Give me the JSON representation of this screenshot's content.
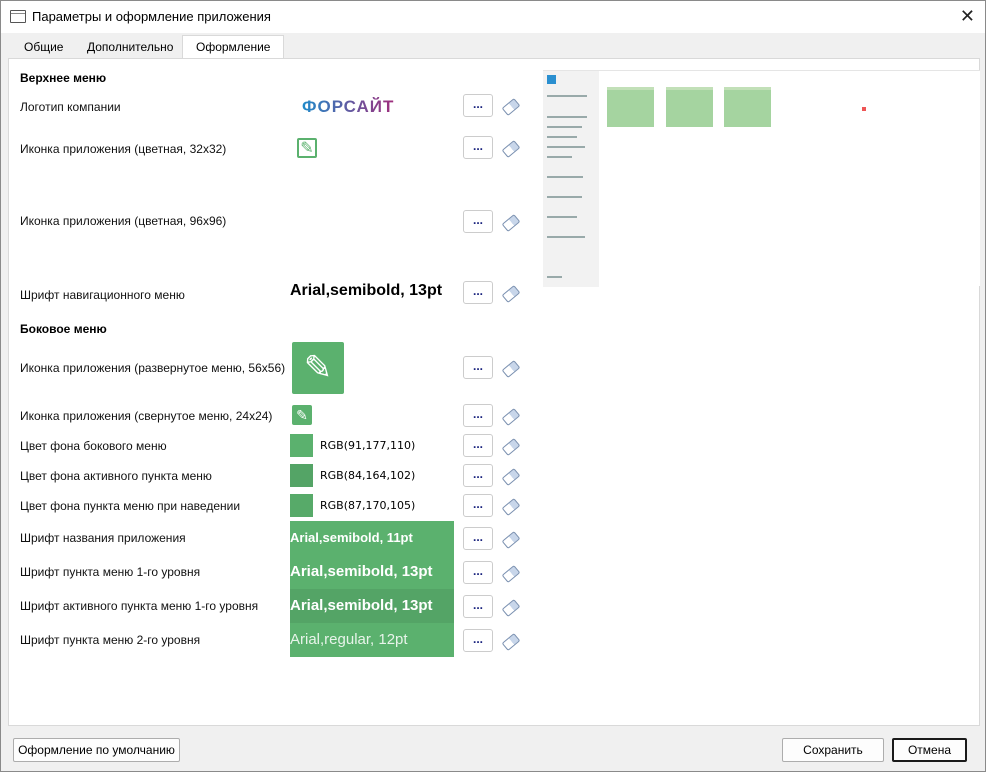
{
  "window": {
    "title": "Параметры и оформление приложения"
  },
  "tabs": [
    {
      "label": "Общие"
    },
    {
      "label": "Дополнительно"
    },
    {
      "label": "Оформление"
    }
  ],
  "top_menu": {
    "header": "Верхнее меню",
    "rows": [
      {
        "label": "Логотип компании",
        "logo_text": "ФОРСАЙТ"
      },
      {
        "label": "Иконка приложения (цветная, 32x32)"
      },
      {
        "label": "Иконка приложения (цветная, 96x96)"
      },
      {
        "label": "Шрифт навигационного меню",
        "value": "Arial,semibold, 13pt"
      }
    ]
  },
  "side_menu": {
    "header": "Боковое меню",
    "rows": [
      {
        "label": "Иконка приложения (развернутое меню, 56x56)"
      },
      {
        "label": "Иконка приложения (свернутое меню, 24x24)"
      },
      {
        "label": "Цвет фона бокового меню",
        "value": "RGB(91,177,110)",
        "color": "#5bb16e"
      },
      {
        "label": "Цвет фона активного пункта меню",
        "value": "RGB(84,164,102)",
        "color": "#54a466"
      },
      {
        "label": "Цвет фона пункта меню при наведении",
        "value": "RGB(87,170,105)",
        "color": "#57aa69"
      },
      {
        "label": "Шрифт названия приложения",
        "value": "Arial,semibold, 11pt"
      },
      {
        "label": "Шрифт пункта меню 1-го уровня",
        "value": "Arial,semibold, 13pt"
      },
      {
        "label": "Шрифт активного пункта меню 1-го уровня",
        "value": "Arial,semibold, 13pt"
      },
      {
        "label": "Шрифт пункта меню 2-го уровня",
        "value": "Arial,regular, 12pt"
      }
    ]
  },
  "browse_label": "...",
  "buttons": {
    "default": "Оформление по умолчанию",
    "save": "Сохранить",
    "cancel": "Отмена"
  }
}
